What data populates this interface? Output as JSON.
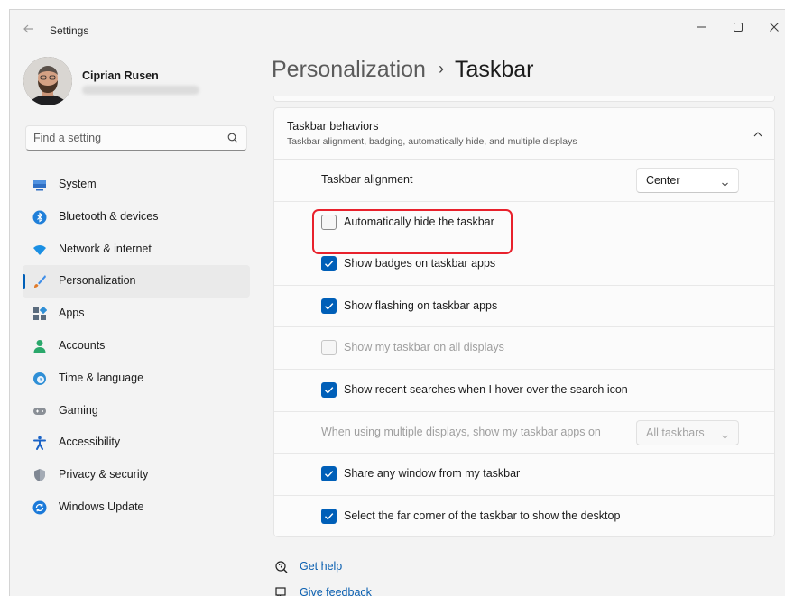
{
  "window": {
    "title": "Settings"
  },
  "profile": {
    "name": "Ciprian Rusen"
  },
  "search": {
    "placeholder": "Find a setting"
  },
  "sidebar": {
    "items": [
      {
        "label": "System",
        "icon": "monitor-icon",
        "color": "#2f6fc4"
      },
      {
        "label": "Bluetooth & devices",
        "icon": "bluetooth-icon",
        "color": "#1f7fd9"
      },
      {
        "label": "Network & internet",
        "icon": "wifi-icon",
        "color": "#1a8fe3"
      },
      {
        "label": "Personalization",
        "icon": "brush-icon",
        "color": "#e07a2a",
        "selected": true
      },
      {
        "label": "Apps",
        "icon": "apps-icon",
        "color": "#5a6b7d"
      },
      {
        "label": "Accounts",
        "icon": "person-icon",
        "color": "#2aa86b"
      },
      {
        "label": "Time & language",
        "icon": "globe-clock-icon",
        "color": "#2f8fd6"
      },
      {
        "label": "Gaming",
        "icon": "gamepad-icon",
        "color": "#8a8f96"
      },
      {
        "label": "Accessibility",
        "icon": "accessibility-icon",
        "color": "#1a63c7"
      },
      {
        "label": "Privacy & security",
        "icon": "shield-icon",
        "color": "#7f8793"
      },
      {
        "label": "Windows Update",
        "icon": "update-icon",
        "color": "#1a79d9"
      }
    ]
  },
  "header": {
    "parent": "Personalization",
    "current": "Taskbar"
  },
  "section": {
    "title": "Taskbar behaviors",
    "subtitle": "Taskbar alignment, badging, automatically hide, and multiple displays"
  },
  "settings": {
    "alignment": {
      "label": "Taskbar alignment",
      "value": "Center"
    },
    "auto_hide": {
      "label": "Automatically hide the taskbar",
      "checked": false
    },
    "badges": {
      "label": "Show badges on taskbar apps",
      "checked": true
    },
    "flashing": {
      "label": "Show flashing on taskbar apps",
      "checked": true
    },
    "all_displays": {
      "label": "Show my taskbar on all displays",
      "checked": false,
      "disabled": true
    },
    "recent_searches": {
      "label": "Show recent searches when I hover over the search icon",
      "checked": true
    },
    "multi_display": {
      "label": "When using multiple displays, show my taskbar apps on",
      "value": "All taskbars",
      "disabled": true
    },
    "share_window": {
      "label": "Share any window from my taskbar",
      "checked": true
    },
    "far_corner": {
      "label": "Select the far corner of the taskbar to show the desktop",
      "checked": true
    }
  },
  "footer": {
    "help": "Get help",
    "feedback": "Give feedback"
  },
  "colors": {
    "accent": "#005fb8",
    "highlight": "#e8212c"
  }
}
